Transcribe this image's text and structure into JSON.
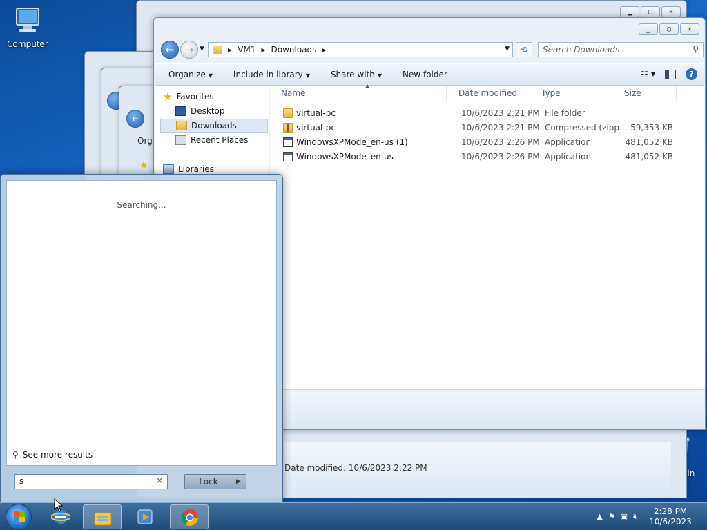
{
  "desktop": {
    "icons": [
      {
        "label": "Computer"
      },
      {
        "label": "cle Bin"
      }
    ]
  },
  "explorer": {
    "address": {
      "segments": [
        "VM1",
        "Downloads"
      ]
    },
    "search_placeholder": "Search Downloads",
    "commands": [
      "Organize",
      "Include in library",
      "Share with",
      "New folder"
    ],
    "nav": [
      {
        "label": "Favorites"
      },
      {
        "label": "Desktop"
      },
      {
        "label": "Downloads",
        "selected": true
      },
      {
        "label": "Recent Places"
      },
      {
        "label": "Libraries"
      }
    ],
    "columns": [
      "Name",
      "Date modified",
      "Type",
      "Size"
    ],
    "files": [
      {
        "name": "virtual-pc",
        "date": "10/6/2023 2:21 PM",
        "type": "File folder",
        "size": "",
        "icon": "folder-icon"
      },
      {
        "name": "virtual-pc",
        "date": "10/6/2023 2:21 PM",
        "type": "Compressed (zipp...",
        "size": "59,353 KB",
        "icon": "zip-icon"
      },
      {
        "name": "WindowsXPMode_en-us (1)",
        "date": "10/6/2023 2:26 PM",
        "type": "Application",
        "size": "481,052 KB",
        "icon": "application-icon"
      },
      {
        "name": "WindowsXPMode_en-us",
        "date": "10/6/2023 2:26 PM",
        "type": "Application",
        "size": "481,052 KB",
        "icon": "application-icon"
      }
    ]
  },
  "back_window": {
    "toolbar_label": "Orga",
    "date_modified_label": "Date modified:",
    "date_modified_value": "10/6/2023 2:22 PM"
  },
  "start_menu": {
    "status": "Searching...",
    "see_more": "See more results",
    "search_value": "s",
    "clear_glyph": "×",
    "lock_label": "Lock"
  },
  "taskbar": {
    "apps": [
      "internet-explorer",
      "windows-explorer",
      "media-player",
      "chrome"
    ],
    "clock": {
      "time": "2:28 PM",
      "date": "10/6/2023"
    }
  }
}
